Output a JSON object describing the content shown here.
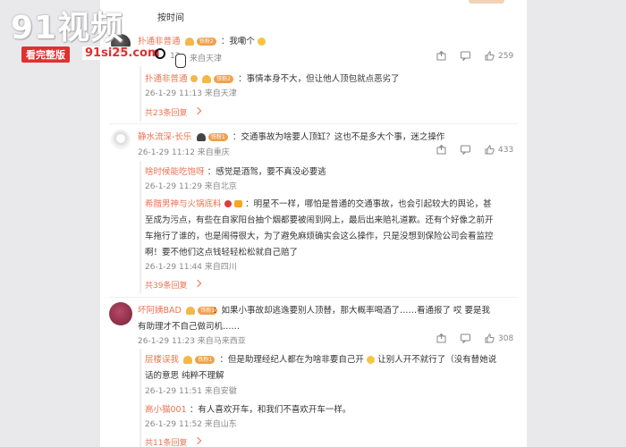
{
  "watermark": {
    "brand": "91视频",
    "banner": "看完整版",
    "site": "91si25.com"
  },
  "sort_label": "按时间",
  "comments": [
    {
      "user": "扑通非普通",
      "badge": "铁粉2",
      "text": "：我嘞个",
      "time": "26-1-29 11:12 来自天津",
      "likes": "259",
      "time_prefix": "12"
    },
    {
      "user": "扑通非普通",
      "badge": "铁粉2",
      "text": "：事情本身不大，但让他人顶包就点恶劣了",
      "time": "26-1-29 11:13 来自天津",
      "is_reply": true
    }
  ],
  "thread1_more": "共23条回复",
  "thread2": {
    "user": "静水流深-长乐",
    "badge": "铁粉1",
    "text": "：交通事故为啥要人顶缸？这也不是多大个事，迷之操作",
    "time": "26-1-29 11:12 来自重庆",
    "likes": "433",
    "replies": [
      {
        "user": "啥时候能吃饱呀",
        "text": "：感觉是酒驾，要不真没必要逃",
        "time": "26-1-29 11:29 来自北京"
      },
      {
        "user": "希腊男神与火锅底料",
        "text": "：明星不一样，哪怕是普通的交通事故，也会引起较大的舆论，甚至成为污点，有些在自家阳台抽个烟都要被闹到网上，最后出来赔礼道歉。还有个好像之前开车拖行了谁的，也是闹得很大，为了避免麻烦确实会这么操作，只是没想到保险公司会看监控啊！要不他们这点钱轻轻松松就自己赔了",
        "time": "26-1-29 11:44 来自四川"
      }
    ],
    "more": "共39条回复"
  },
  "thread3": {
    "user": "坏阿姨BAD",
    "badge": "铁粉1",
    "text": "：如果小事故却逃逸要别人顶替，那大概率喝酒了……看通报了 哎 要是我有助理才不自己做司机……",
    "time": "26-1-29 11:23 来自马来西亚",
    "likes": "308",
    "replies": [
      {
        "user": "层楼误我",
        "badge": "铁粉1",
        "text": "：但是助理经纪人都在为啥非要自己开",
        "text2": "让别人开不就行了（没有替她说话的意思 纯粹不理解",
        "time": "26-1-29 11:51 来自安徽"
      },
      {
        "user": "高小猫001",
        "text": "：有人喜欢开车，和我们不喜欢开车一样。",
        "time": "26-1-29 11:52 来自山东"
      }
    ],
    "more": "共11条回复"
  },
  "icons": [
    "share-icon",
    "comment-icon",
    "like-icon"
  ]
}
